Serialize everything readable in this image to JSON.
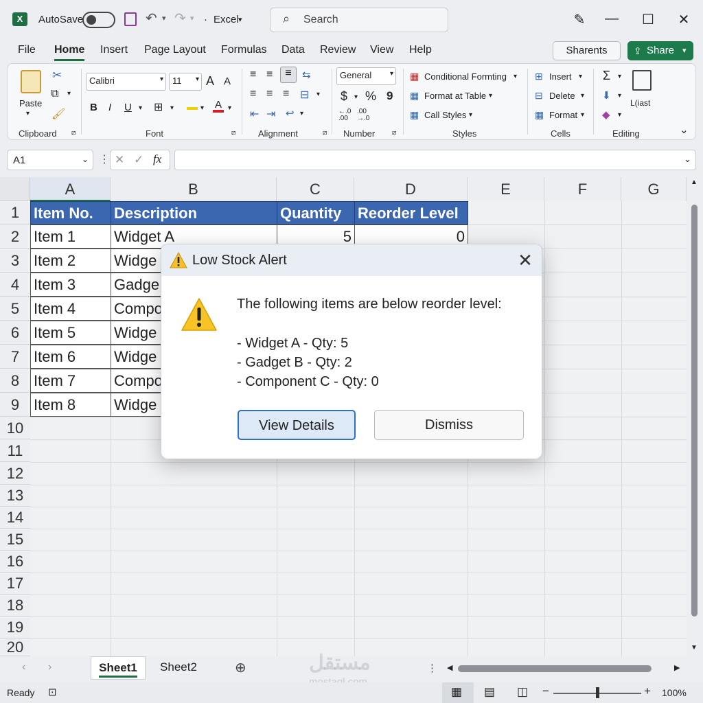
{
  "titlebar": {
    "autosave_label": "AutoSave",
    "app_name": "Excel",
    "search_placeholder": "Search"
  },
  "menu": [
    "File",
    "Home",
    "Insert",
    "Page Layout",
    "Formulas",
    "Data",
    "Review",
    "View",
    "Help"
  ],
  "actions": {
    "sharents": "Sharents",
    "share": "Share"
  },
  "ribbon": {
    "clipboard": {
      "paste": "Paste",
      "label": "Clipboard"
    },
    "font": {
      "name": "Calibri",
      "size": "11",
      "label": "Font",
      "bold": "B",
      "italic": "I",
      "underline": "U",
      "grow": "A",
      "shrink": "A"
    },
    "alignment": {
      "label": "Alignment"
    },
    "number": {
      "format": "General",
      "currency": "$",
      "percent": "%",
      "comma": "9",
      "label": "Number",
      "inc": "←.0 .00",
      "dec": ".00 →.0"
    },
    "styles": {
      "conditional": "Conditional Formting",
      "format_table": "Format at Table",
      "cell_styles": "Call Styles",
      "label": "Styles"
    },
    "cells": {
      "insert": "Insert",
      "delete": "Delete",
      "format": "Format",
      "label": "Cells"
    },
    "editing": {
      "sum": "Σ",
      "extra": "L(iast",
      "label": "Editing"
    }
  },
  "formula_bar": {
    "name_box": "A1",
    "fx": "fx",
    "value": ""
  },
  "columns": [
    "A",
    "B",
    "C",
    "D",
    "E",
    "F",
    "G"
  ],
  "rows": [
    "1",
    "2",
    "3",
    "4",
    "5",
    "6",
    "7",
    "8",
    "9",
    "10",
    "11",
    "12",
    "13",
    "14",
    "15",
    "16",
    "17",
    "18",
    "19",
    "20"
  ],
  "table": {
    "headers": [
      "Item No.",
      "Description",
      "Quantity",
      "Reorder Level"
    ],
    "rows": [
      [
        "Item 1",
        "Widget A",
        "5",
        "0"
      ],
      [
        "Item 2",
        "Widge",
        "",
        ""
      ],
      [
        "Item 3",
        "Gadge",
        "",
        ""
      ],
      [
        "Item 4",
        "Compo",
        "",
        ""
      ],
      [
        "Item 5",
        "Widge",
        "",
        ""
      ],
      [
        "Item 6",
        "Widge",
        "",
        ""
      ],
      [
        "Item 7",
        "Compo",
        "",
        ""
      ],
      [
        "Item 8",
        "Widge",
        "",
        ""
      ]
    ]
  },
  "dialog": {
    "title": "Low Stock Alert",
    "message": "The following items are below reorder level:",
    "items": [
      "- Widget A - Qty: 5",
      "- Gadget B - Qty: 2",
      "- Component C - Qty: 0"
    ],
    "primary": "View Details",
    "secondary": "Dismiss"
  },
  "sheets": [
    "Sheet1",
    "Sheet2"
  ],
  "status": {
    "ready": "Ready",
    "zoom": "100%"
  },
  "watermark": {
    "arabic": "مستقل",
    "latin": "mostaql.com"
  }
}
